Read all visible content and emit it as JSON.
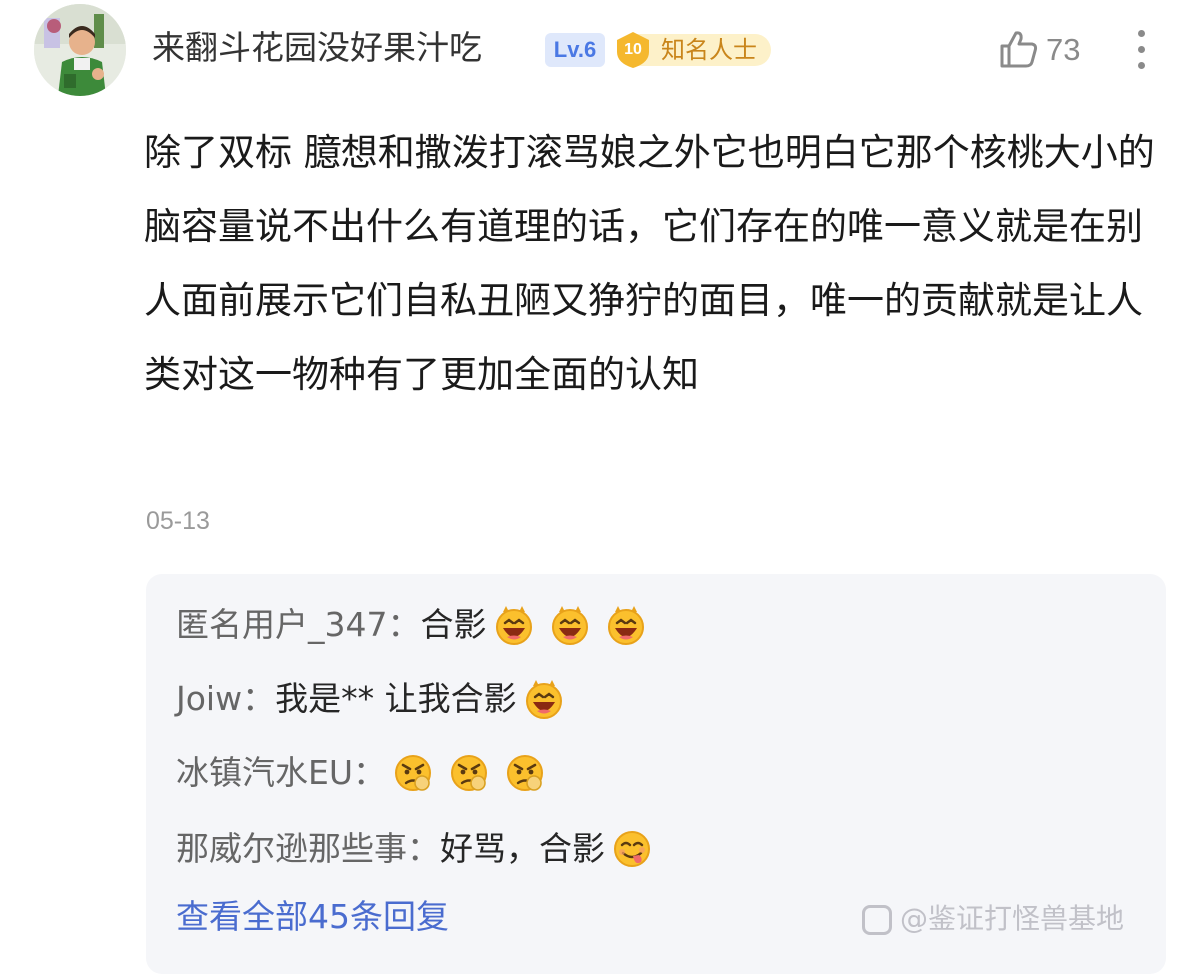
{
  "comment": {
    "author": "来翻斗花园没好果汁吃",
    "level_badge": "Lv.6",
    "honor_badge": {
      "number": "10",
      "title": "知名人士"
    },
    "like_count": "73",
    "body": "除了双标 臆想和撒泼打滚骂娘之外它也明白它那个核桃大小的脑容量说不出什么有道理的话，它们存在的唯一意义就是在别人面前展示它们自私丑陋又狰狞的面目，唯一的贡献就是让人类对这一物种有了更加全面的认知",
    "date": "05-13"
  },
  "replies": [
    {
      "author": "匿名用户_347：",
      "text": "合影",
      "emojis": [
        "laughing-emoji",
        "laughing-emoji",
        "laughing-emoji"
      ]
    },
    {
      "author": "Joiw：",
      "text": "我是** 让我合影",
      "emojis": [
        "laughing-emoji"
      ]
    },
    {
      "author": "冰镇汽水EU：",
      "text": "",
      "emojis": [
        "angry-emoji",
        "angry-emoji",
        "angry-emoji"
      ]
    },
    {
      "author": "那威尔逊那些事：",
      "text": "好骂，合影",
      "emojis": [
        "tongue-out-emoji"
      ]
    }
  ],
  "view_all_replies": "查看全部45条回复",
  "watermark": "@鉴证打怪兽基地",
  "colors": {
    "link": "#4a6ccf",
    "level_badge_bg": "#dfe8fb",
    "level_badge_text": "#4a78e4",
    "honor_badge": "#f5b82e",
    "reply_panel_bg": "#f5f6f9"
  }
}
